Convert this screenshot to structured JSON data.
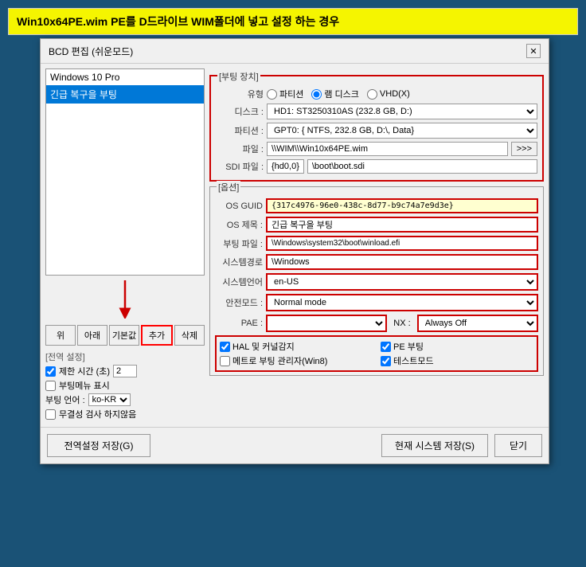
{
  "banner": {
    "text": "Win10x64PE.wim PE를 D드라이브 WIM폴더에 넣고 설정 하는 경우"
  },
  "dialog": {
    "title": "BCD 편집 (쉬운모드)",
    "close_label": "✕"
  },
  "left_panel": {
    "list_items": [
      {
        "label": "Windows 10 Pro",
        "selected": false
      },
      {
        "label": "긴급 복구을 부팅",
        "selected": true
      }
    ],
    "buttons": {
      "up": "위",
      "down": "아래",
      "default": "기본값",
      "add": "추가",
      "delete": "삭제"
    },
    "global_settings_label": "[전역 설정]",
    "timeout_label": "제한 시간 (초)",
    "timeout_value": "2",
    "timeout_checked": true,
    "bootmenu_label": "부팅메뉴 표시",
    "bootmenu_checked": false,
    "language_label": "부팅 언어 :",
    "language_value": "ko-KR",
    "nodebug_label": "무결성 검사 하지않음",
    "nodebug_checked": false
  },
  "boot_device_group": {
    "label": "[부팅 장치]",
    "type_label": "유형",
    "radio_options": [
      {
        "label": "파티션",
        "value": "partition",
        "selected": false
      },
      {
        "label": "램 디스크",
        "value": "ramdisk",
        "selected": true
      },
      {
        "label": "VHD(X)",
        "value": "vhd",
        "selected": false
      }
    ],
    "disk_label": "디스크 :",
    "disk_value": "HD1: ST3250310AS (232.8 GB, D:)",
    "partition_label": "파티션 :",
    "partition_value": "GPT0: { NTFS, 232.8 GB, D:\\, Data}",
    "file_label": "파일 :",
    "file_value": "\\\\WIM\\\\Win10x64PE.wim",
    "sdi_label": "SDI 파일 :",
    "sdi_prefix": "{hd0,0}",
    "sdi_value": "\\boot\\boot.sdi"
  },
  "options_group": {
    "label": "[옵션]",
    "osguid_label": "OS GUID",
    "osguid_value": "{317c4976-96e0-438c-8d77-b9c74a7e9d3e}",
    "ostitle_label": "OS 제목 :",
    "ostitle_value": "긴급 복구을 부팅",
    "bootfile_label": "부팅 파일 :",
    "bootfile_value": "\\Windows\\system32\\boot\\winload.efi",
    "syspath_label": "시스템경로",
    "syspath_value": "\\Windows",
    "syslang_label": "시스템언어",
    "syslang_value": "en-US",
    "safemode_label": "안전모드 :",
    "safemode_value": "Normal mode",
    "pae_label": "PAE :",
    "pae_value": "",
    "nx_label": "NX :",
    "nx_value": "Always Off",
    "hal_label": "HAL 및 커널감지",
    "hal_checked": true,
    "pe_label": "PE 부팅",
    "pe_checked": true,
    "metro_label": "메트로 부팅 관리자(Win8)",
    "metro_checked": false,
    "testmode_label": "테스트모드",
    "testmode_checked": true
  },
  "footer": {
    "save_all_label": "전역설정 저장(G)",
    "save_current_label": "현재 시스템 저장(S)",
    "close_label": "닫기"
  }
}
